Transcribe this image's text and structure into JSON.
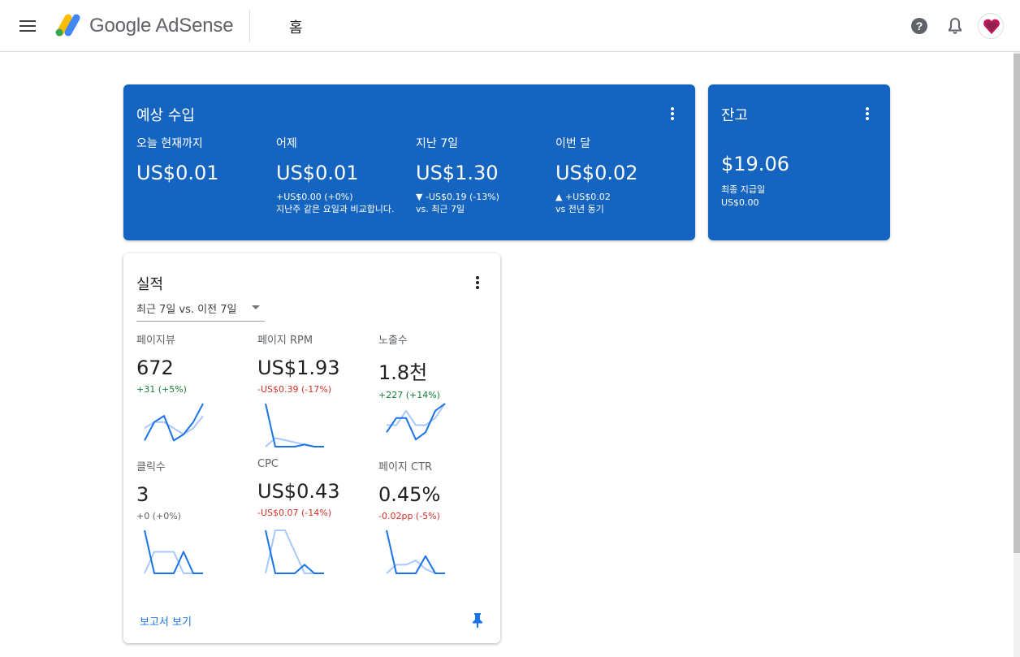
{
  "header": {
    "brand": "Google AdSense",
    "page_title": "홈",
    "icons": [
      "menu-icon",
      "help-icon",
      "bell-icon",
      "avatar"
    ]
  },
  "earnings": {
    "title": "예상 수입",
    "columns": [
      {
        "label": "오늘 현재까지",
        "value": "US$0.01",
        "sub": ""
      },
      {
        "label": "어제",
        "value": "US$0.01",
        "sub": "+US$0.00 (+0%)\n지난주 같은 요일과 비교합니다."
      },
      {
        "label": "지난 7일",
        "value": "US$1.30",
        "sub": "▼ -US$0.19 (-13%)\nvs. 최근 7일"
      },
      {
        "label": "이번 달",
        "value": "US$0.02",
        "sub": "▲ +US$0.02\nvs 전년 동기"
      }
    ]
  },
  "balance": {
    "title": "잔고",
    "value": "$19.06",
    "last_payment_label": "최종 지급일",
    "last_payment_value": "US$0.00"
  },
  "performance": {
    "title": "실적",
    "range": "최근 7일 vs. 이전 7일",
    "metrics": [
      {
        "label": "페이지뷰",
        "value": "672",
        "change": "+31 (+5%)",
        "trend": "pos",
        "current": [
          1,
          4,
          5,
          1,
          2,
          4,
          7
        ],
        "previous": [
          3,
          4,
          4,
          3,
          2,
          3,
          5
        ]
      },
      {
        "label": "페이지 RPM",
        "value": "US$1.93",
        "change": "-US$0.39 (-17%)",
        "trend": "neg",
        "current": [
          10,
          0,
          0,
          0,
          0.5,
          0,
          0
        ],
        "previous": [
          0,
          2,
          1.5,
          1,
          0.5,
          0,
          0
        ]
      },
      {
        "label": "노출수",
        "value": "1.8천",
        "change": "+227 (+14%)",
        "trend": "pos",
        "current": [
          2,
          4,
          4,
          1,
          2,
          5,
          6
        ],
        "previous": [
          3,
          3,
          5,
          3,
          3,
          4,
          6
        ]
      },
      {
        "label": "클릭수",
        "value": "3",
        "change": "+0 (+0%)",
        "trend": "neu",
        "current": [
          2,
          0,
          0,
          0,
          1,
          0,
          0
        ],
        "previous": [
          0,
          1,
          1,
          1,
          0,
          0,
          0
        ]
      },
      {
        "label": "CPC",
        "value": "US$0.43",
        "change": "-US$0.07 (-14%)",
        "trend": "neg",
        "current": [
          2,
          0,
          0,
          0,
          0.4,
          0,
          0
        ],
        "previous": [
          0,
          2,
          2,
          1,
          0,
          0,
          0
        ]
      },
      {
        "label": "페이지 CTR",
        "value": "0.45%",
        "change": "-0.02pp (-5%)",
        "trend": "neg",
        "current": [
          4,
          0,
          0,
          0,
          1.6,
          0,
          0
        ],
        "previous": [
          0,
          0.8,
          0.8,
          1.2,
          0.4,
          0,
          0
        ]
      }
    ],
    "report_link": "보고서 보기"
  },
  "colors": {
    "card_blue": "#1565c0",
    "spark_current": "#1a73e8",
    "spark_previous": "#a8c7fa",
    "positive": "#188038",
    "negative": "#d93025"
  }
}
